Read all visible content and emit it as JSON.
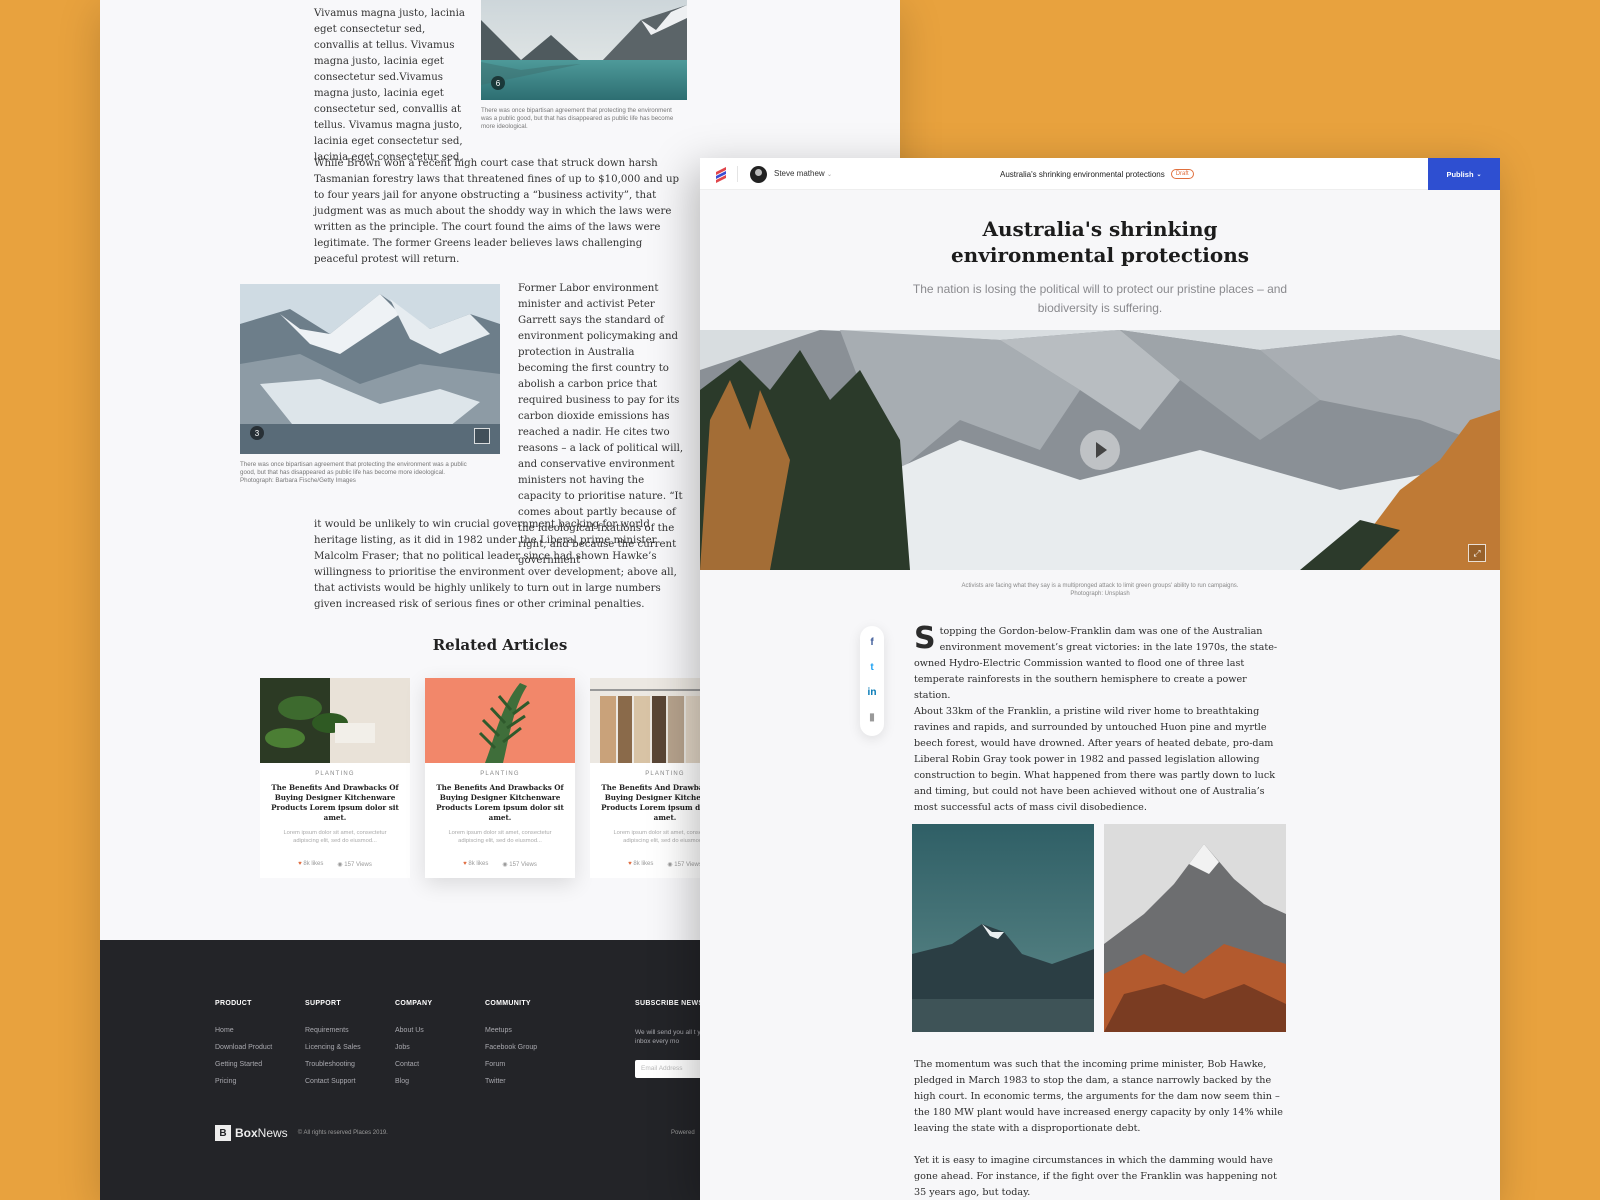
{
  "back": {
    "para1": "Vivamus magna justo, lacinia eget consectetur sed, convallis at tellus. Vivamus magna justo, lacinia eget consectetur sed.Vivamus magna justo, lacinia eget consectetur sed, convallis at tellus. Vivamus magna justo, lacinia eget consectetur sed, lacinia eget consectetur sed,",
    "lake_caption": "There was once bipartisan agreement that protecting the environment was a public good, but that has disappeared as public life has become more ideological.",
    "lake_count": "6",
    "para2": "While Brown won a recent high court case that struck down harsh Tasmanian forestry laws that threatened fines of up to $10,000 and up to four years jail for anyone obstructing a “business activity”, that judgment was as much about the shoddy way in which the laws were written as the principle. The court found the aims of the laws were legitimate. The former Greens leader believes laws challenging peaceful protest will return.",
    "para3": "Former Labor environment minister and activist Peter Garrett says the standard of environment policymaking and protection in Australia becoming the first country to abolish a carbon price that required business to pay for its carbon dioxide emissions has reached a nadir.  He cites two reasons – a lack of political will, and conservative environment ministers not having the capacity to prioritise nature. “It comes about partly because of the ideological fixations of the right, and because the current government",
    "glacier_caption": "There was once bipartisan agreement that protecting the environment was a public good, but that has disappeared as public life has become more ideological.",
    "glacier_credit": "Photograph: Barbara Fische/Getty Images",
    "glacier_count": "3",
    "para4": "it would be unlikely to win crucial government backing for world heritage listing, as it did in 1982 under the Liberal prime minister Malcolm Fraser; that no political leader since had shown Hawke’s willingness to prioritise the environment over development; above all, that activists would be highly unlikely to turn out in large numbers given increased risk of serious fines or other criminal penalties.",
    "related_title": "Related Articles",
    "cards": [
      {
        "category": "PLANTING",
        "title": "The Benefits And Drawbacks Of Buying Designer Kitchenware Products Lorem ipsum dolor sit amet.",
        "excerpt": "Lorem ipsum dolor sit amet, consectetur adipiscing elit, sed do eiusmod...",
        "likes": "8k likes",
        "views": "157 Views"
      },
      {
        "category": "PLANTING",
        "title": "The Benefits And Drawbacks Of Buying Designer Kitchenware Products Lorem ipsum dolor sit amet.",
        "excerpt": "Lorem ipsum dolor sit amet, consectetur adipiscing elit, sed do eiusmod...",
        "likes": "8k likes",
        "views": "157 Views"
      },
      {
        "category": "PLANTING",
        "title": "The Benefits And Drawbacks Of Buying Designer Kitchenware Products Lorem ipsum dolor sit amet.",
        "excerpt": "Lorem ipsum dolor sit amet, consectetur adipiscing elit, sed do eiusmod...",
        "likes": "8k likes",
        "views": "157 Views"
      }
    ],
    "footer": {
      "columns": [
        {
          "heading": "PRODUCT",
          "links": [
            "Home",
            "Download Product",
            "Getting Started",
            "Pricing"
          ]
        },
        {
          "heading": "SUPPORT",
          "links": [
            "Requirements",
            "Licencing & Sales",
            "Troubleshooting",
            "Contact Support"
          ]
        },
        {
          "heading": "COMPANY",
          "links": [
            "About Us",
            "Jobs",
            "Contact",
            "Blog"
          ]
        },
        {
          "heading": "COMMUNITY",
          "links": [
            "Meetups",
            "Facebook Group",
            "Forum",
            "Twitter"
          ]
        }
      ],
      "subscribe_heading": "SUBSCRIBE NEWSLE",
      "subscribe_text": "We will send you all t your inbox every mo",
      "email_placeholder": "Email Address",
      "brand_logo": "B",
      "brand_bold": "Box",
      "brand_rest": "News",
      "copyright": "© All rights reserved Places 2019.",
      "powered": "Powered"
    }
  },
  "editor": {
    "user_name": "Steve mathew",
    "doc_title": "Australia's shrinking environmental protections",
    "status": "Draft",
    "publish_label": "Publish",
    "headline": "Australia's shrinking environmental protections",
    "standfirst": "The nation is losing the political will to protect our pristine places – and biodiversity is suffering.",
    "hero_caption": "Activists are facing what they say is a multipronged attack to limit green groups' ability to run campaigns.",
    "hero_credit": "Photograph: Unsplash",
    "dropcap": "S",
    "p1": "topping the Gordon-below-Franklin dam was one of the Australian environment movement’s great victories: in the late 1970s, the state-owned Hydro-Electric Commission wanted to flood one of three last temperate rainforests in the southern hemisphere to create a power station.",
    "p2": "About 33km of the Franklin, a pristine wild river home to breathtaking ravines and rapids, and surrounded by untouched Huon pine and myrtle beech forest, would have drowned. After years of heated debate, pro-dam Liberal Robin Gray took power in 1982 and passed legislation allowing construction to begin. What happened from there was partly down to luck and timing, but could not have been achieved without one of Australia’s most successful acts of mass civil disobedience.",
    "p3": "The momentum was such that the incoming prime minister, Bob Hawke, pledged in March 1983 to stop the dam, a stance narrowly backed by the high court. In economic terms, the arguments for the dam now seem thin – the 180 MW plant would have increased energy capacity by only 14% while leaving the state with a disproportionate debt.",
    "p4": "Yet it is easy to imagine circumstances in which the damming would have gone ahead. For instance, if the fight over the Franklin was happening not 35 years ago, but today.",
    "social": [
      {
        "icon": "facebook-icon",
        "glyph": "f",
        "color": "#3b5998"
      },
      {
        "icon": "twitter-icon",
        "glyph": "t",
        "color": "#1da1f2"
      },
      {
        "icon": "linkedin-icon",
        "glyph": "in",
        "color": "#0077b5"
      },
      {
        "icon": "bookmark-icon",
        "glyph": "▮",
        "color": "#999999"
      }
    ]
  },
  "colors": {
    "background": "#e8a23e",
    "publish": "#2e4fd1",
    "draft": "#e0703e",
    "footer": "#232428"
  }
}
